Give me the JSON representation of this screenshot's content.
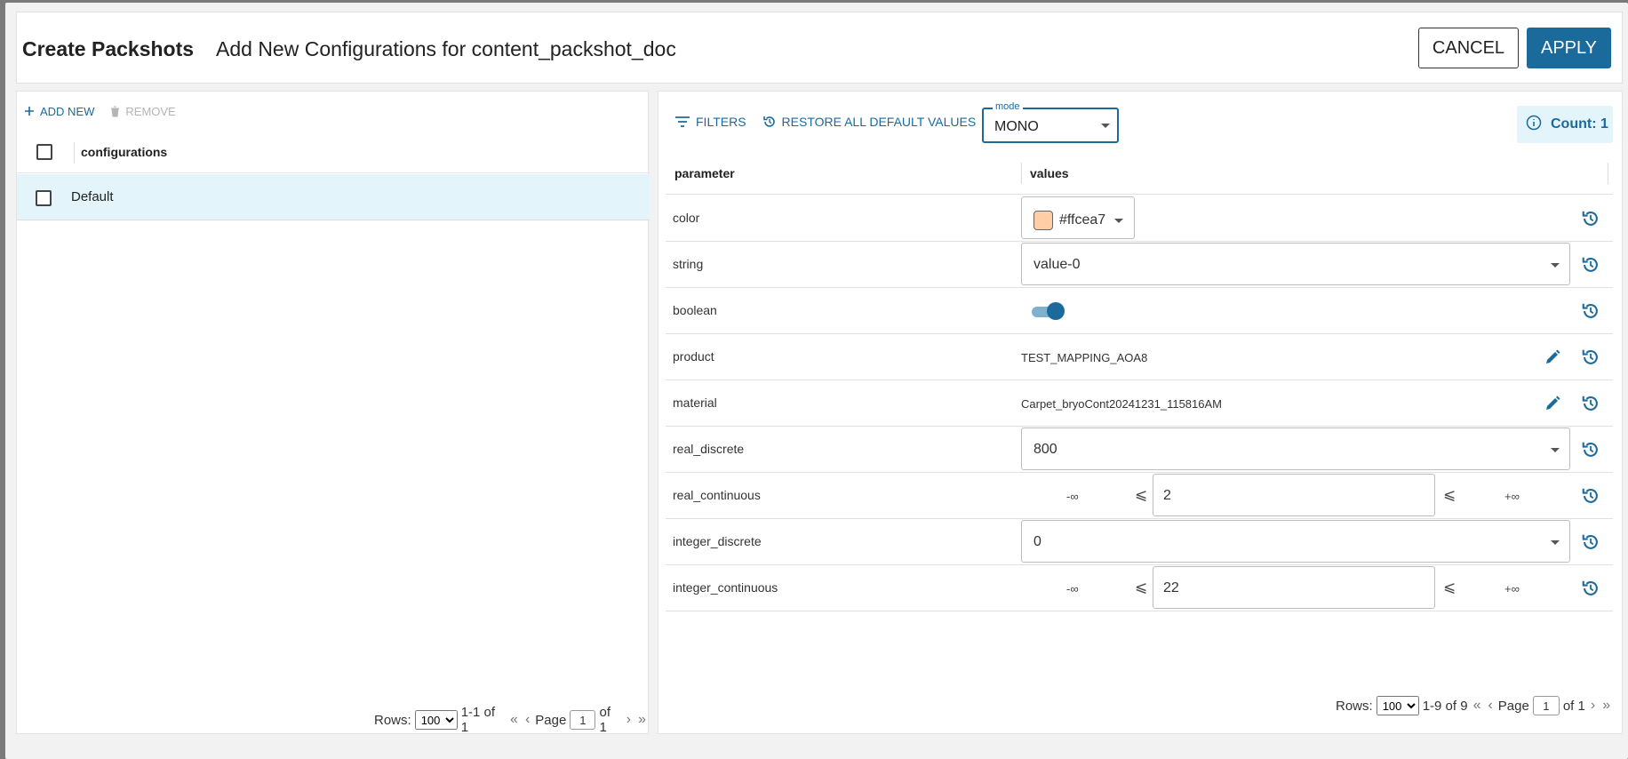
{
  "header": {
    "title": "Create Packshots",
    "subtitle": "Add New Configurations for content_packshot_doc",
    "cancel_label": "CANCEL",
    "apply_label": "APPLY"
  },
  "left": {
    "add_new_label": "ADD NEW",
    "remove_label": "REMOVE",
    "column_title": "configurations",
    "rows": [
      {
        "label": "Default"
      }
    ],
    "pager": {
      "rows_label": "Rows:",
      "rows_per_page": "100",
      "range": "1-1 of 1",
      "page_label": "Page",
      "page": "1",
      "of_pages": "of 1"
    }
  },
  "right": {
    "filters_label": "FILTERS",
    "restore_label": "RESTORE ALL DEFAULT VALUES",
    "mode": {
      "label": "mode",
      "value": "MONO"
    },
    "count_label": "Count: 1",
    "headers": {
      "parameter": "parameter",
      "values": "values"
    },
    "params": {
      "color": {
        "name": "color",
        "value": "#ffcea7",
        "swatch": "#ffcea7"
      },
      "string": {
        "name": "string",
        "value": "value-0"
      },
      "boolean": {
        "name": "boolean",
        "value": "true"
      },
      "product": {
        "name": "product",
        "value": "TEST_MAPPING_AOA8"
      },
      "material": {
        "name": "material",
        "value": "Carpet_bryoCont20241231_115816AM"
      },
      "real_discrete": {
        "name": "real_discrete",
        "value": "800"
      },
      "real_continuous": {
        "name": "real_continuous",
        "min": "-∞",
        "le": "⩽",
        "value": "2",
        "max": "+∞"
      },
      "integer_discrete": {
        "name": "integer_discrete",
        "value": "0"
      },
      "integer_continuous": {
        "name": "integer_continuous",
        "min": "-∞",
        "le": "⩽",
        "value": "22",
        "max": "+∞"
      }
    },
    "pager": {
      "rows_label": "Rows:",
      "rows_per_page": "100",
      "range": "1-9 of 9",
      "page_label": "Page",
      "page": "1",
      "of_pages": "of 1"
    }
  },
  "colors": {
    "accent": "#1b6a9c",
    "selected_row": "#e4f4fb"
  },
  "icons": {
    "add": "plus-icon",
    "remove": "trash-icon",
    "filters": "filter-icon",
    "restore": "history-icon",
    "info": "info-icon",
    "edit": "pencil-icon",
    "reset": "history-icon"
  }
}
